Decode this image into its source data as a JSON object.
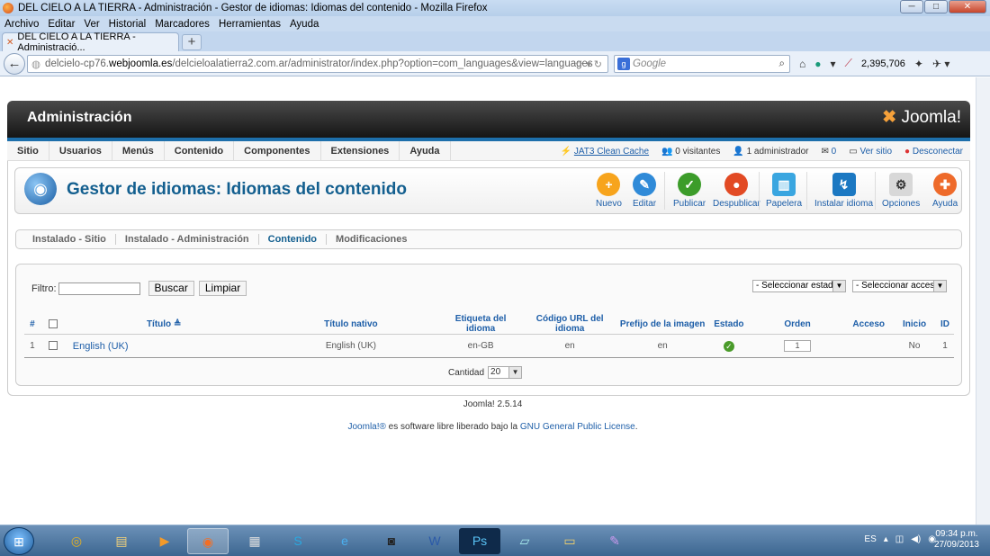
{
  "window": {
    "title": "DEL CIELO A LA TIERRA - Administración - Gestor de idiomas: Idiomas del contenido - Mozilla Firefox",
    "controls": [
      "─",
      "□",
      "✕"
    ]
  },
  "menubar": [
    "Archivo",
    "Editar",
    "Ver",
    "Historial",
    "Marcadores",
    "Herramientas",
    "Ayuda"
  ],
  "tab": {
    "label": "DEL CIELO A LA TIERRA - Administració...",
    "new_tab": "+"
  },
  "nav": {
    "url_prefix": "delcielo-cp76.",
    "url_host": "webjoomla.es",
    "url_rest": "/delcieloalatierra2.com.ar/administrator/index.php?option=com_languages&view=languages",
    "search_placeholder": "Google",
    "counter": "2,395,706"
  },
  "header": {
    "title": "Administración",
    "logo": "Joomla!"
  },
  "admin_menu": [
    "Sitio",
    "Usuarios",
    "Menús",
    "Contenido",
    "Componentes",
    "Extensiones",
    "Ayuda"
  ],
  "status": {
    "cache": "JAT3 Clean Cache",
    "visitors": "0 visitantes",
    "admins": "1 administrador",
    "messages": "0",
    "view_site": "Ver sitio",
    "logout": "Desconectar"
  },
  "page_title": "Gestor de idiomas: Idiomas del contenido",
  "toolbar": [
    {
      "label": "Nuevo",
      "icon": "plus-icon",
      "color": "#f7a41d",
      "glyph": "+"
    },
    {
      "label": "Editar",
      "icon": "pencil-icon",
      "color": "#2f8ad8",
      "glyph": "✎"
    },
    {
      "label": "Publicar",
      "icon": "check-icon",
      "color": "#3c9c2a",
      "glyph": "✓"
    },
    {
      "label": "Despublicar",
      "icon": "unpublish-icon",
      "color": "#e24a24",
      "glyph": "●"
    },
    {
      "label": "Papelera",
      "icon": "trash-icon",
      "color": "#3aa6e0",
      "glyph": "🗑"
    },
    {
      "label": "Instalar idioma",
      "icon": "install-icon",
      "color": "#1b78c2",
      "glyph": "↯"
    },
    {
      "label": "Opciones",
      "icon": "options-icon",
      "color": "#d8d8d8",
      "glyph": "⚙"
    },
    {
      "label": "Ayuda",
      "icon": "lifebuoy-icon",
      "color": "#ee6a2a",
      "glyph": "✚"
    }
  ],
  "subnav": [
    "Instalado - Sitio",
    "Instalado - Administración",
    "Contenido",
    "Modificaciones"
  ],
  "filter": {
    "label": "Filtro:",
    "search": "Buscar",
    "clear": "Limpiar",
    "state": "- Seleccionar estado -",
    "access": "- Seleccionar acceso -"
  },
  "table": {
    "headers": [
      "#",
      "",
      "Título",
      "Título nativo",
      "Etiqueta del idioma",
      "Código URL del idioma",
      "Prefijo de la imagen",
      "Estado",
      "Orden",
      "Acceso",
      "Inicio",
      "ID"
    ],
    "rows": [
      {
        "num": "1",
        "title": "English (UK)",
        "native": "English (UK)",
        "tag": "en-GB",
        "sef": "en",
        "image": "en",
        "order": "1",
        "access": "",
        "home": "No",
        "id": "1"
      }
    ]
  },
  "pagination": {
    "label": "Cantidad",
    "value": "20"
  },
  "footer": {
    "version": "Joomla! 2.5.14",
    "link1": "Joomla!®",
    "text": " es software libre liberado bajo la ",
    "link2": "GNU General Public License",
    "end": "."
  },
  "taskbar": {
    "lang": "ES",
    "time": "09:34 p.m.",
    "date": "27/09/2013"
  }
}
